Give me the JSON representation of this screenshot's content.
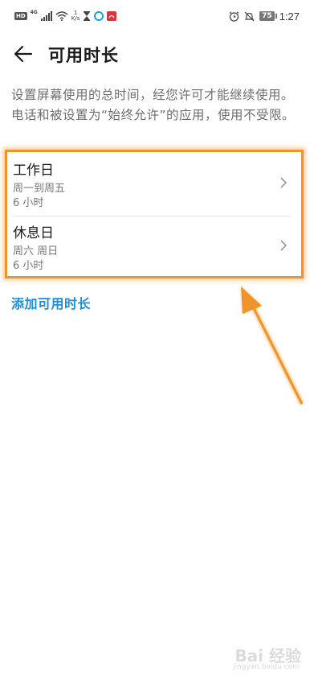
{
  "status_bar": {
    "left_badge": "HD",
    "network": "4G",
    "speed_value": "1",
    "speed_unit": "K/s",
    "battery": "75",
    "time": "1:27"
  },
  "header": {
    "title": "可用时长"
  },
  "description": "设置屏幕使用的总时间，经您许可才能继续使用。电话和被设置为“始终允许”的应用，使用不受限。",
  "schedules": [
    {
      "title": "工作日",
      "days": "周一到周五",
      "duration": "6 小时"
    },
    {
      "title": "休息日",
      "days": "周六 周日",
      "duration": "6 小时"
    }
  ],
  "add_link": "添加可用时长",
  "watermark": {
    "text": "Bai 经验",
    "url": "jingyan.baidu.com"
  },
  "colors": {
    "accent": "#1890e4",
    "highlight": "#f0932b"
  }
}
